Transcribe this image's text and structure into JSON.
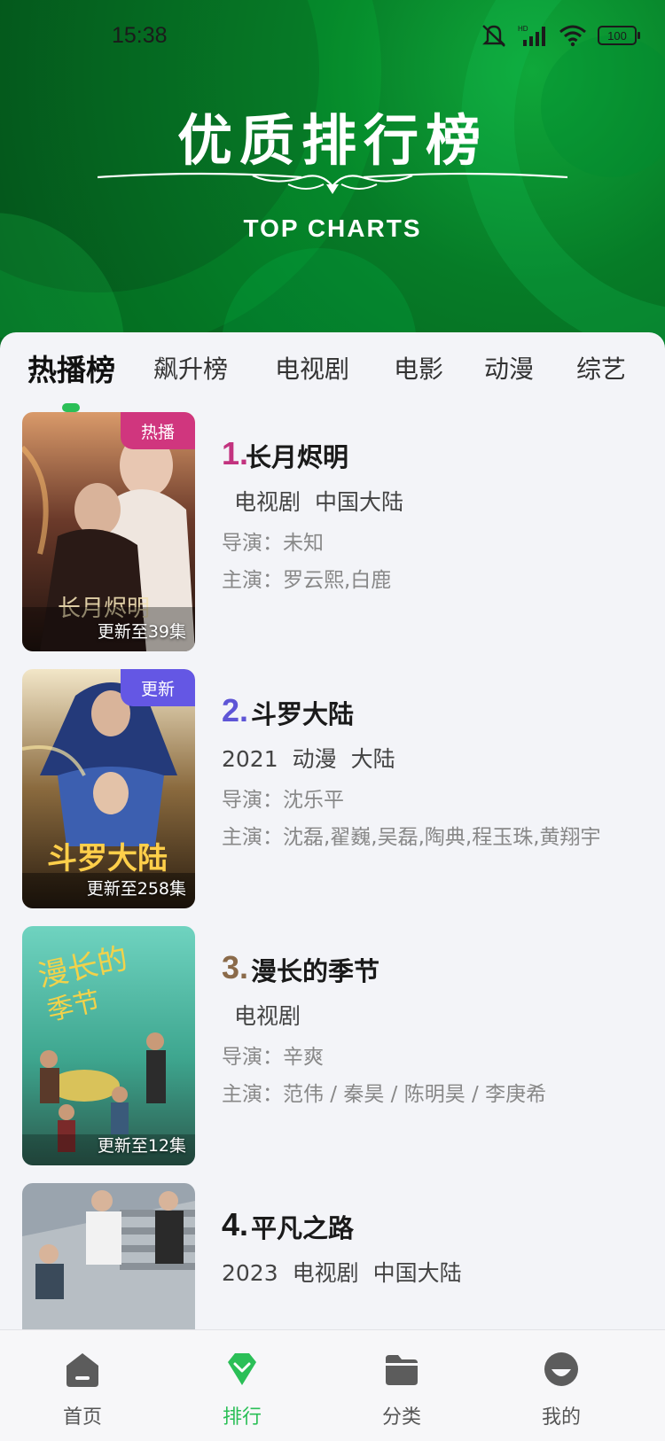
{
  "status_bar": {
    "time": "15:38",
    "battery": "100",
    "signal_label": "HD"
  },
  "banner": {
    "title": "优质排行榜",
    "subtitle": "TOP CHARTS"
  },
  "tabs": [
    {
      "label": "热播榜",
      "active": true
    },
    {
      "label": "飙升榜",
      "active": false
    },
    {
      "label": "电视剧",
      "active": false
    },
    {
      "label": "电影",
      "active": false
    },
    {
      "label": "动漫",
      "active": false
    },
    {
      "label": "综艺",
      "active": false
    }
  ],
  "items": [
    {
      "rank": "1.",
      "rank_color": "#c2337f",
      "title": "长月烬明",
      "badge": "热播",
      "badge_color": "#d0367e",
      "update": "更新至39集",
      "year": "",
      "genre": "电视剧",
      "region": "中国大陆",
      "director": "导演：未知",
      "cast": "主演：罗云熙,白鹿"
    },
    {
      "rank": "2.",
      "rank_color": "#5e55d6",
      "title": "斗罗大陆",
      "badge": "更新",
      "badge_color": "#6457e4",
      "update": "更新至258集",
      "year": "2021",
      "genre": "动漫",
      "region": "大陆",
      "director": "导演：沈乐平",
      "cast": "主演：沈磊,翟巍,吴磊,陶典,程玉珠,黄翔宇"
    },
    {
      "rank": "3.",
      "rank_color": "#8a6a4a",
      "title": "漫长的季节",
      "badge": "",
      "badge_color": "",
      "update": "更新至12集",
      "year": "",
      "genre": "电视剧",
      "region": "",
      "director": "导演：辛爽",
      "cast": "主演：范伟 / 秦昊 / 陈明昊 / 李庚希"
    },
    {
      "rank": "4.",
      "rank_color": "#1a1a1a",
      "title": "平凡之路",
      "badge": "",
      "badge_color": "",
      "update": "",
      "year": "2023",
      "genre": "电视剧",
      "region": "中国大陆",
      "director": "",
      "cast": ""
    }
  ],
  "bottom_nav": [
    {
      "label": "首页",
      "icon": "home-icon",
      "active": false
    },
    {
      "label": "排行",
      "icon": "ranking-icon",
      "active": true
    },
    {
      "label": "分类",
      "icon": "folder-icon",
      "active": false
    },
    {
      "label": "我的",
      "icon": "profile-icon",
      "active": false
    }
  ],
  "colors": {
    "accent": "#2bbf57",
    "header_green": "#067c27"
  }
}
